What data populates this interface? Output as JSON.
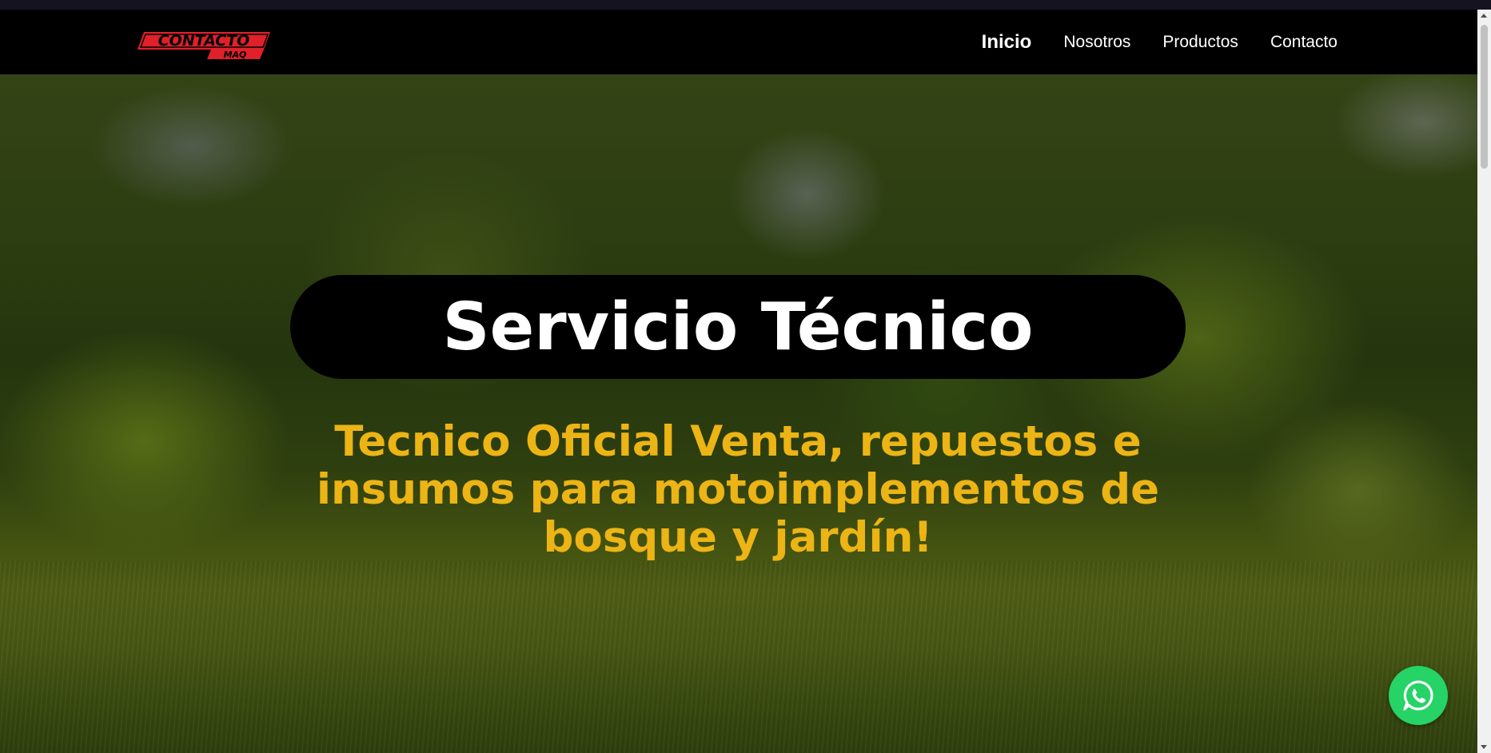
{
  "brand": {
    "logo_top": "CONTACTO",
    "logo_bottom": "MAQ"
  },
  "nav": {
    "items": [
      {
        "label": "Inicio",
        "active": true
      },
      {
        "label": "Nosotros",
        "active": false
      },
      {
        "label": "Productos",
        "active": false
      },
      {
        "label": "Contacto",
        "active": false
      }
    ]
  },
  "hero": {
    "title": "Servicio Técnico",
    "subtitle": "Tecnico Oficial Venta, repuestos e insumos para motoimplementos de bosque y jardín!"
  },
  "whatsapp": {
    "icon": "whatsapp-icon"
  },
  "colors": {
    "navbar": "#000000",
    "accent_yellow": "#ecb414",
    "logo_red": "#e0202a",
    "whatsapp_green": "#25d366"
  }
}
